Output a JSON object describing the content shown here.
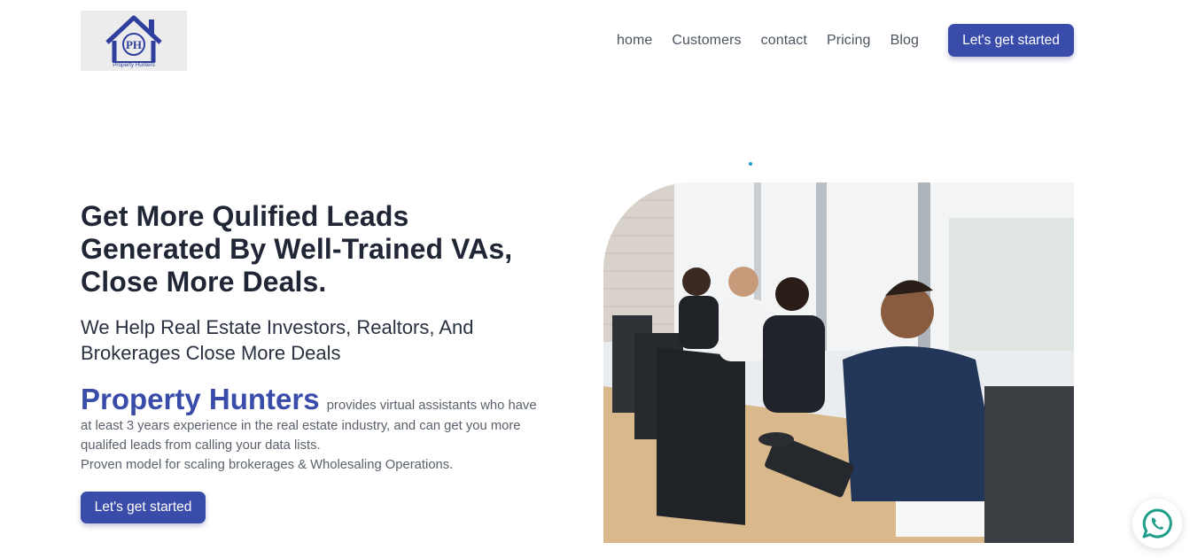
{
  "header": {
    "logo": {
      "monogram": "PH",
      "tagline": "Property Hunters",
      "icon": "house-logo-icon"
    },
    "nav": [
      {
        "label": "home"
      },
      {
        "label": "Customers"
      },
      {
        "label": "contact"
      },
      {
        "label": "Pricing"
      },
      {
        "label": "Blog"
      }
    ],
    "cta_label": "Let's get started"
  },
  "hero": {
    "headline_lines": [
      "Get More Qulified Leads",
      "Generated By Well-Trained VAs,",
      "Close More Deals."
    ],
    "subhead_lines": [
      "We Help Real Estate Investors, Realtors, And",
      "Brokerages Close More Deals"
    ],
    "brand_name": "Property Hunters",
    "description": "provides virtual assistants who have at least 3 years experience in the real estate industry, and can get you more qualifed leads from calling your data lists.",
    "proof_line": "Proven model for scaling brokerages & Wholesaling Operations.",
    "cta_label": "Let's get started",
    "image_icon": "call-center-photo"
  },
  "floating": {
    "whatsapp_icon": "whatsapp-icon"
  },
  "colors": {
    "accent": "#3a4ca9",
    "heading": "#202635",
    "body_text": "#5a616c",
    "nav_text": "#4b5360",
    "dot": "#17a3c9"
  }
}
